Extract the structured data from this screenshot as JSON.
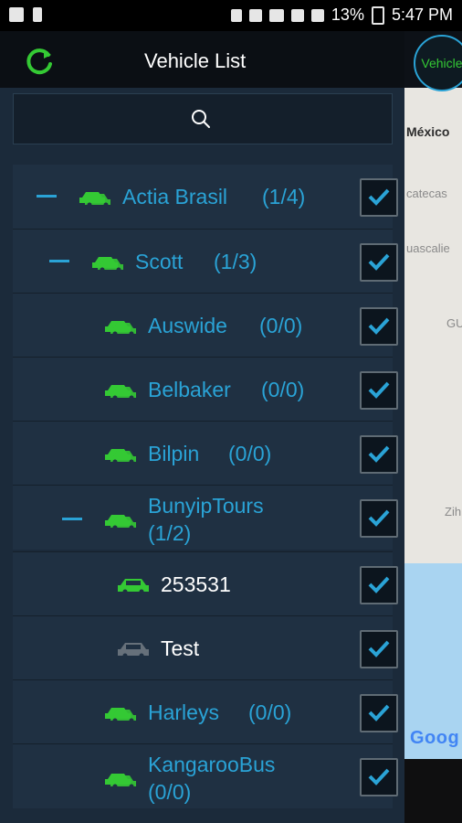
{
  "status_bar": {
    "battery_percent": "13%",
    "time": "5:47 PM"
  },
  "header": {
    "title": "Vehicle List",
    "vehicle_button_label": "Vehicle"
  },
  "map": {
    "labels": [
      "México",
      "catecas",
      "uascalie",
      "GU",
      "Zih"
    ],
    "watermark": "Goog"
  },
  "tree": {
    "items": [
      {
        "name": "Actia Brasil",
        "count": "(1/4)",
        "level": 0,
        "expanded": true,
        "checked": true
      },
      {
        "name": "Scott",
        "count": "(1/3)",
        "level": 1,
        "expanded": true,
        "checked": true
      },
      {
        "name": "Auswide",
        "count": "(0/0)",
        "level": 2,
        "expanded": false,
        "checked": true
      },
      {
        "name": "Belbaker",
        "count": "(0/0)",
        "level": 2,
        "expanded": false,
        "checked": true
      },
      {
        "name": "Bilpin",
        "count": "(0/0)",
        "level": 2,
        "expanded": false,
        "checked": true
      },
      {
        "name": "BunyipTours",
        "count": "(1/2)",
        "level": 1,
        "expanded": true,
        "checked": true
      },
      {
        "name": "253531",
        "count": "",
        "level": 3,
        "vehicle": true,
        "online": true,
        "checked": true
      },
      {
        "name": "Test",
        "count": "",
        "level": 3,
        "vehicle": true,
        "online": false,
        "checked": true
      },
      {
        "name": "Harleys",
        "count": "(0/0)",
        "level": 2,
        "expanded": false,
        "checked": true
      },
      {
        "name": "KangarooBus",
        "count": "(0/0)",
        "level": 2,
        "expanded": false,
        "checked": true
      }
    ]
  },
  "colors": {
    "accent_blue": "#2aa3d6",
    "online_green": "#34c934",
    "offline_gray": "#66707a"
  }
}
